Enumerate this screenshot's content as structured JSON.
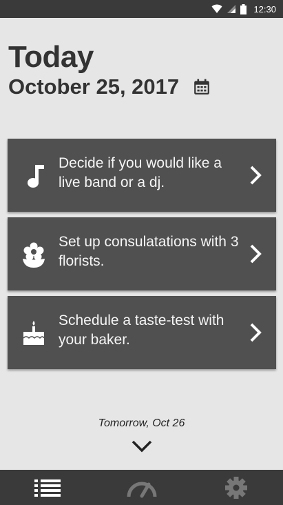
{
  "status_bar": {
    "time": "12:30",
    "icons": [
      "wifi-icon",
      "cellular-signal-icon",
      "battery-icon"
    ]
  },
  "header": {
    "title": "Today",
    "date": "October 25, 2017",
    "calendar_icon": "calendar-icon"
  },
  "tasks": [
    {
      "icon": "music-note-icon",
      "text": "Decide if you would like a live band or a dj."
    },
    {
      "icon": "flower-icon",
      "text": "Set up consulatations with 3 florists."
    },
    {
      "icon": "cake-icon",
      "text": "Schedule a taste-test with your baker."
    }
  ],
  "footer": {
    "tomorrow_label": "Tomorrow, Oct 26"
  },
  "bottom_nav": {
    "items": [
      {
        "icon": "list-icon",
        "active": true
      },
      {
        "icon": "speedometer-icon",
        "active": false
      },
      {
        "icon": "settings-gear-icon",
        "active": false
      }
    ]
  },
  "colors": {
    "background": "#e6e6e6",
    "card": "#505050",
    "bars": "#3a3a3a",
    "text_dark": "#333333"
  }
}
